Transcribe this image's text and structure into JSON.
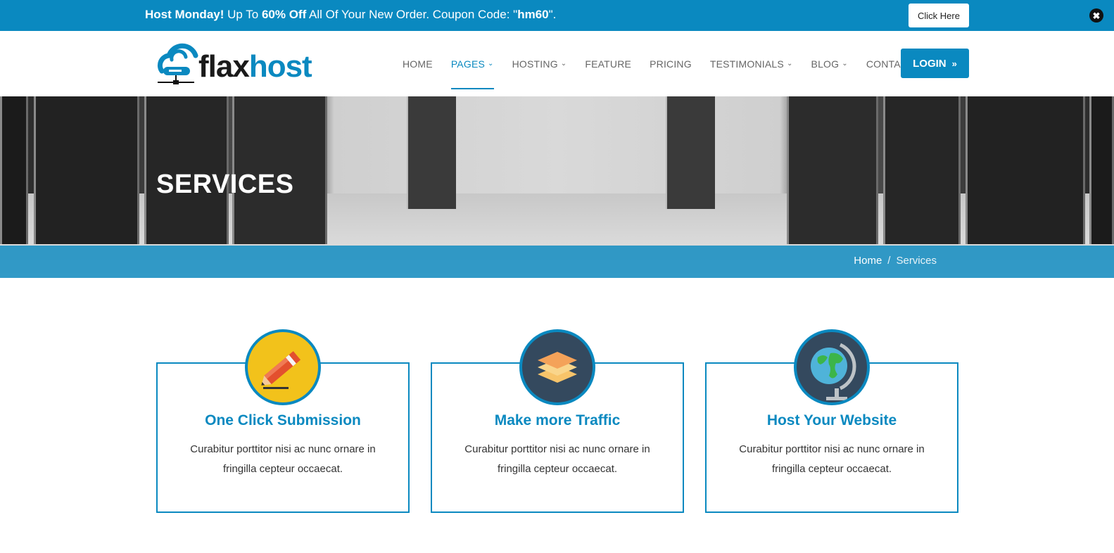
{
  "promo": {
    "lead": "Host Monday!",
    "text1": " Up To ",
    "discount": "60% Off",
    "text2": " All Of Your New Order. Coupon Code: \"",
    "code": "hm60",
    "text3": "\".",
    "button_label": "Click Here",
    "close_glyph": "✖"
  },
  "brand": {
    "name_part1": "flax",
    "name_part2": "host",
    "accent_color": "#0a89c0"
  },
  "nav": {
    "items": [
      {
        "label": "HOME",
        "dropdown": false,
        "active": false
      },
      {
        "label": "PAGES",
        "dropdown": true,
        "active": true
      },
      {
        "label": "HOSTING",
        "dropdown": true,
        "active": false
      },
      {
        "label": "FEATURE",
        "dropdown": false,
        "active": false
      },
      {
        "label": "PRICING",
        "dropdown": false,
        "active": false
      },
      {
        "label": "TESTIMONIALS",
        "dropdown": true,
        "active": false
      },
      {
        "label": "BLOG",
        "dropdown": true,
        "active": false
      },
      {
        "label": "CONTACT",
        "dropdown": false,
        "active": false
      }
    ],
    "login_label": "LOGIN",
    "login_icon": "»"
  },
  "hero": {
    "title": "SERVICES",
    "breadcrumb": {
      "home": "Home",
      "separator": "/",
      "current": "Services"
    }
  },
  "services": [
    {
      "title": "One Click Submission",
      "description": "Curabitur porttitor nisi ac nunc ornare in fringilla cepteur occaecat.",
      "icon": "pencil-icon"
    },
    {
      "title": "Make more Traffic",
      "description": "Curabitur porttitor nisi ac nunc ornare in fringilla cepteur occaecat.",
      "icon": "layers-icon"
    },
    {
      "title": "Host Your Website",
      "description": "Curabitur porttitor nisi ac nunc ornare in fringilla cepteur occaecat.",
      "icon": "globe-icon"
    }
  ]
}
